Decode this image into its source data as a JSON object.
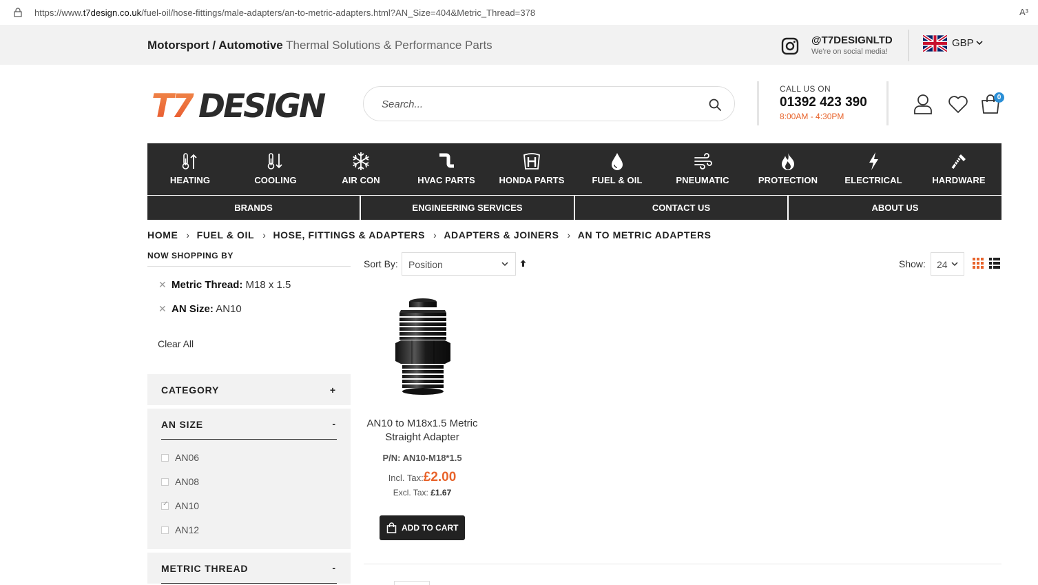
{
  "browser": {
    "url_prefix": "https://www.",
    "url_domain": "t7design.co.uk",
    "url_path": "/fuel-oil/hose-fittings/male-adapters/an-to-metric-adapters.html?AN_Size=404&Metric_Thread=378",
    "read_aloud": "A³"
  },
  "topbar": {
    "tagline_strong": "Motorsport / Automotive",
    "tagline_light": "Thermal Solutions & Performance Parts",
    "social_handle": "@T7DESIGNLTD",
    "social_sub": "We're on social media!",
    "currency": "GBP"
  },
  "header": {
    "search_placeholder": "Search...",
    "call_label": "CALL US ON",
    "call_number": "01392 423 390",
    "call_hours": "8:00AM - 4:30PM",
    "cart_count": "0"
  },
  "nav": {
    "items": [
      {
        "label": "HEATING",
        "icon": "heating-icon"
      },
      {
        "label": "COOLING",
        "icon": "cooling-icon"
      },
      {
        "label": "AIR CON",
        "icon": "snowflake-icon"
      },
      {
        "label": "HVAC PARTS",
        "icon": "pipe-icon"
      },
      {
        "label": "HONDA PARTS",
        "icon": "honda-icon"
      },
      {
        "label": "FUEL & OIL",
        "icon": "droplet-icon"
      },
      {
        "label": "PNEUMATIC",
        "icon": "wind-icon"
      },
      {
        "label": "PROTECTION",
        "icon": "flame-icon"
      },
      {
        "label": "ELECTRICAL",
        "icon": "lightning-icon"
      },
      {
        "label": "HARDWARE",
        "icon": "screw-icon"
      }
    ],
    "sub": [
      {
        "label": "BRANDS"
      },
      {
        "label": "ENGINEERING SERVICES"
      },
      {
        "label": "CONTACT US"
      },
      {
        "label": "ABOUT US"
      }
    ]
  },
  "breadcrumb": {
    "items": [
      "HOME",
      "FUEL & OIL",
      "HOSE, FITTINGS & ADAPTERS",
      "ADAPTERS & JOINERS",
      "AN TO METRIC ADAPTERS"
    ],
    "separator": "›"
  },
  "sidebar": {
    "now_shopping": "NOW SHOPPING BY",
    "filters": [
      {
        "name": "Metric Thread:",
        "value": "M18 x 1.5"
      },
      {
        "name": "AN Size:",
        "value": "AN10"
      }
    ],
    "remove_glyph": "✕",
    "clear_all": "Clear All",
    "category": {
      "title": "CATEGORY",
      "toggle": "+"
    },
    "an_size": {
      "title": "AN SIZE",
      "toggle": "-",
      "options": [
        {
          "label": "AN06",
          "checked": false
        },
        {
          "label": "AN08",
          "checked": false
        },
        {
          "label": "AN10",
          "checked": true
        },
        {
          "label": "AN12",
          "checked": false
        }
      ]
    },
    "metric_thread": {
      "title": "METRIC THREAD",
      "toggle": "-"
    }
  },
  "toolbar": {
    "sort_label": "Sort By:",
    "sort_value": "Position",
    "show_label": "Show:",
    "show_value": "24"
  },
  "product": {
    "name": "AN10 to M18x1.5 Metric Straight Adapter",
    "sku": "P/N: AN10-M18*1.5",
    "incl_label": "Incl. Tax:",
    "incl_price": "£2.00",
    "excl_label": "Excl. Tax:",
    "excl_price": "£1.67",
    "add_to_cart": "ADD TO CART"
  },
  "colors": {
    "accent": "#e8642c",
    "nav_bg": "#2b2b2b",
    "badge": "#2b8fd6"
  }
}
